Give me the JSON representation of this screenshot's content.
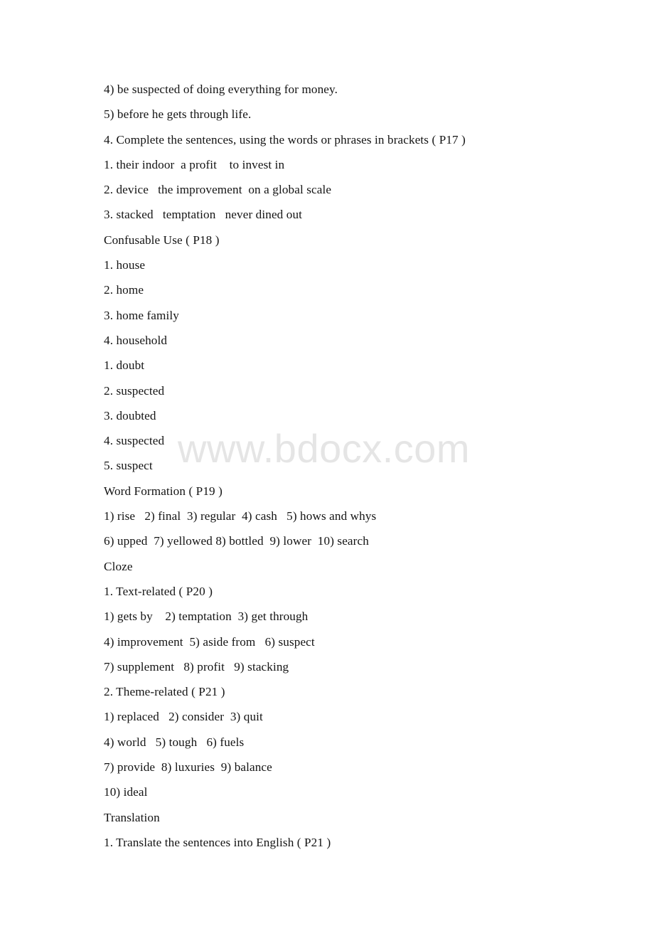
{
  "document": {
    "background_color": "#ffffff",
    "text_color": "#141414",
    "watermark": {
      "text": "www.bdocx.com",
      "color": "#e5e5e5"
    },
    "lines": [
      {
        "id": "line-01",
        "text": "4) be suspected of doing everything for money."
      },
      {
        "id": "line-02",
        "text": "5) before he gets through life."
      },
      {
        "id": "line-03",
        "text": "4. Complete the sentences, using the words or phrases in brackets ( P17 )"
      },
      {
        "id": "line-04",
        "text": "1. their indoor  a profit    to invest in"
      },
      {
        "id": "line-05",
        "text": "2. device   the improvement  on a global scale"
      },
      {
        "id": "line-06",
        "text": "3. stacked   temptation   never dined out"
      },
      {
        "id": "line-07",
        "text": "Confusable Use ( P18 )"
      },
      {
        "id": "line-08",
        "text": "1. house"
      },
      {
        "id": "line-09",
        "text": "2. home"
      },
      {
        "id": "line-10",
        "text": "3. home family"
      },
      {
        "id": "line-11",
        "text": "4. household"
      },
      {
        "id": "line-12",
        "text": "1. doubt"
      },
      {
        "id": "line-13",
        "text": "2. suspected"
      },
      {
        "id": "line-14",
        "text": "3. doubted"
      },
      {
        "id": "line-15",
        "text": "4. suspected"
      },
      {
        "id": "line-16",
        "text": "5. suspect"
      },
      {
        "id": "line-17",
        "text": "Word Formation ( P19 )"
      },
      {
        "id": "line-18",
        "text": "1) rise   2) final  3) regular  4) cash   5) hows and whys"
      },
      {
        "id": "line-19",
        "text": "6) upped  7) yellowed 8) bottled  9) lower  10) search"
      },
      {
        "id": "line-20",
        "text": "Cloze"
      },
      {
        "id": "line-21",
        "text": "1. Text-related ( P20 )"
      },
      {
        "id": "line-22",
        "text": "1) gets by    2) temptation  3) get through"
      },
      {
        "id": "line-23",
        "text": "4) improvement  5) aside from   6) suspect"
      },
      {
        "id": "line-24",
        "text": "7) supplement   8) profit   9) stacking"
      },
      {
        "id": "line-25",
        "text": "2. Theme-related ( P21 )"
      },
      {
        "id": "line-26",
        "text": "1) replaced   2) consider  3) quit"
      },
      {
        "id": "line-27",
        "text": "4) world   5) tough   6) fuels"
      },
      {
        "id": "line-28",
        "text": "7) provide  8) luxuries  9) balance"
      },
      {
        "id": "line-29",
        "text": "10) ideal"
      },
      {
        "id": "line-30",
        "text": "Translation"
      },
      {
        "id": "line-31",
        "text": "1. Translate the sentences into English ( P21 )"
      }
    ]
  }
}
